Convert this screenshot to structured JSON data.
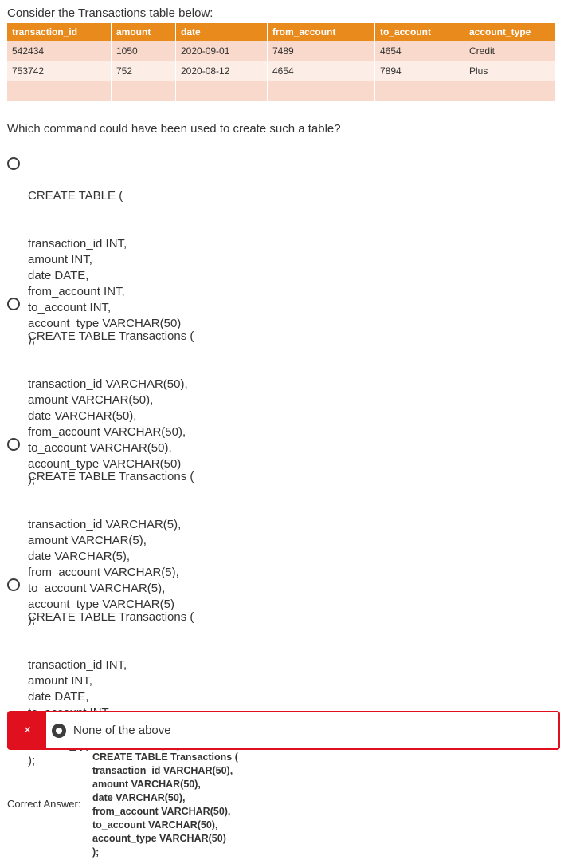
{
  "intro": "Consider the Transactions table below:",
  "table": {
    "headers": [
      "transaction_id",
      "amount",
      "date",
      "from_account",
      "to_account",
      "account_type"
    ],
    "rows": [
      [
        "542434",
        "1050",
        "2020-09-01",
        "7489",
        "4654",
        "Credit"
      ],
      [
        "753742",
        "752",
        "2020-08-12",
        "4654",
        "7894",
        "Plus"
      ],
      [
        "...",
        "...",
        "...",
        "...",
        "...",
        "..."
      ]
    ]
  },
  "question": "Which command could have been used to create such a table?",
  "options": [
    {
      "first": "CREATE TABLE (",
      "body": "transaction_id INT,\namount INT,\ndate DATE,\nfrom_account INT,\nto_account INT,\naccount_type VARCHAR(50)\n);"
    },
    {
      "first": "CREATE TABLE Transactions (",
      "body": "transaction_id VARCHAR(50),\namount VARCHAR(50),\ndate VARCHAR(50),\nfrom_account VARCHAR(50),\nto_account VARCHAR(50),\naccount_type VARCHAR(50)\n);"
    },
    {
      "first": "CREATE TABLE Transactions (",
      "body": "transaction_id VARCHAR(5),\namount VARCHAR(5),\ndate VARCHAR(5),\nfrom_account VARCHAR(5),\nto_account VARCHAR(5),\naccount_type VARCHAR(5)\n);"
    },
    {
      "first": "CREATE TABLE Transactions (",
      "body": "transaction_id INT,\namount INT,\ndate DATE,\nto_account INT,\nfrom_account INT,\naccount_type VARCHAR(50)\n);"
    }
  ],
  "selected": {
    "label": "None of the above",
    "marker": "×",
    "marker_icon": "close-icon",
    "status_color": "#e0101e"
  },
  "correct": {
    "label": "Correct Answer:",
    "text": "CREATE TABLE Transactions (\ntransaction_id VARCHAR(50),\namount VARCHAR(50),\ndate VARCHAR(50),\nfrom_account VARCHAR(50),\nto_account VARCHAR(50),\naccount_type VARCHAR(50)\n);"
  },
  "colors": {
    "header_bg": "#e98a1d",
    "row_dark": "#f8d9cb",
    "row_light": "#fcede6"
  }
}
